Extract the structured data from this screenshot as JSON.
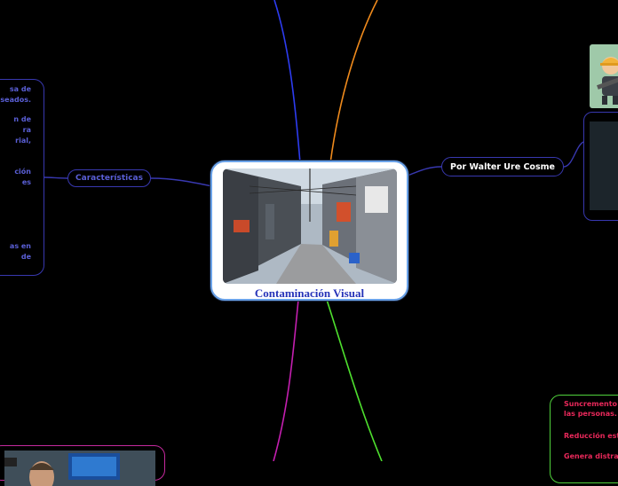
{
  "central": {
    "title": "Contaminación Visual",
    "image_icon": "street-photo"
  },
  "author_topic": {
    "label": "Por Walter Ure Cosme"
  },
  "characteristics_topic": {
    "label": "Características"
  },
  "left_notes": {
    "lines": [
      "sa de",
      "seados.",
      "",
      "n de",
      "ra",
      "rial,",
      "",
      "ción",
      "es",
      "",
      "",
      "",
      "",
      "as en",
      "de"
    ]
  },
  "right_notes": {
    "lines": [
      "Suncremento",
      "las personas.",
      "",
      "Reducción est",
      "",
      "Genera distra"
    ]
  },
  "images": {
    "worker_icon": "construction-worker-icon",
    "dark_image_icon": "dark-thumbnail-icon",
    "person_image_icon": "person-photo-icon"
  },
  "colors": {
    "background": "#000000",
    "central_border": "#6aa2e8",
    "central_title": "#2633b8",
    "topic_border": "#3838b0",
    "topic_text": "#5a5fd6",
    "branch_blue": "#2d3cf0",
    "branch_orange": "#ef8a1c",
    "branch_green": "#4ee02e",
    "branch_magenta": "#c41fb0",
    "notes_red": "#e8285a"
  }
}
